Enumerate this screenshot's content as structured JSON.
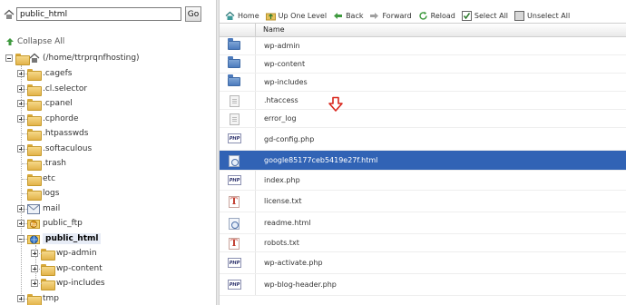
{
  "left_pane": {
    "path_value": "public_html",
    "go_label": "Go",
    "collapse_label": "Collapse All",
    "root_label": "(/home/ttrprqnfhosting)",
    "tree": [
      {
        "label": ".cagefs",
        "expander": "plus"
      },
      {
        "label": ".cl.selector",
        "expander": "plus"
      },
      {
        "label": ".cpanel",
        "expander": "plus"
      },
      {
        "label": ".cphorde",
        "expander": "plus"
      },
      {
        "label": ".htpasswds",
        "expander": "none"
      },
      {
        "label": ".softaculous",
        "expander": "plus"
      },
      {
        "label": ".trash",
        "expander": "none"
      },
      {
        "label": "etc",
        "expander": "none"
      },
      {
        "label": "logs",
        "expander": "none"
      },
      {
        "label": "mail",
        "expander": "plus"
      },
      {
        "label": "public_ftp",
        "expander": "plus"
      },
      {
        "label": "public_html",
        "expander": "minus",
        "selected": true
      },
      {
        "label": "wp-admin",
        "expander": "plus",
        "child": true
      },
      {
        "label": "wp-content",
        "expander": "plus",
        "child": true
      },
      {
        "label": "wp-includes",
        "expander": "plus",
        "child": true
      },
      {
        "label": "tmp",
        "expander": "plus"
      }
    ]
  },
  "toolbar": {
    "home": "Home",
    "up_one_level": "Up One Level",
    "back": "Back",
    "forward": "Forward",
    "reload": "Reload",
    "select_all": "Select All",
    "unselect_all": "Unselect All"
  },
  "file_list": {
    "header_name": "Name",
    "files": [
      {
        "name": "wp-admin",
        "type": "folder"
      },
      {
        "name": "wp-content",
        "type": "folder"
      },
      {
        "name": "wp-includes",
        "type": "folder"
      },
      {
        "name": ".htaccess",
        "type": "file"
      },
      {
        "name": "error_log",
        "type": "file"
      },
      {
        "name": "gd-config.php",
        "type": "php"
      },
      {
        "name": "google85177ceb5419e27f.html",
        "type": "html",
        "selected": true
      },
      {
        "name": "index.php",
        "type": "php"
      },
      {
        "name": "license.txt",
        "type": "txt"
      },
      {
        "name": "readme.html",
        "type": "html"
      },
      {
        "name": "robots.txt",
        "type": "txt"
      },
      {
        "name": "wp-activate.php",
        "type": "php"
      },
      {
        "name": "wp-blog-header.php",
        "type": "php"
      }
    ]
  },
  "colors": {
    "selection": "#3163b5",
    "folder_blue": "#4d7bbd",
    "annotation_arrow": "#d9261c"
  }
}
